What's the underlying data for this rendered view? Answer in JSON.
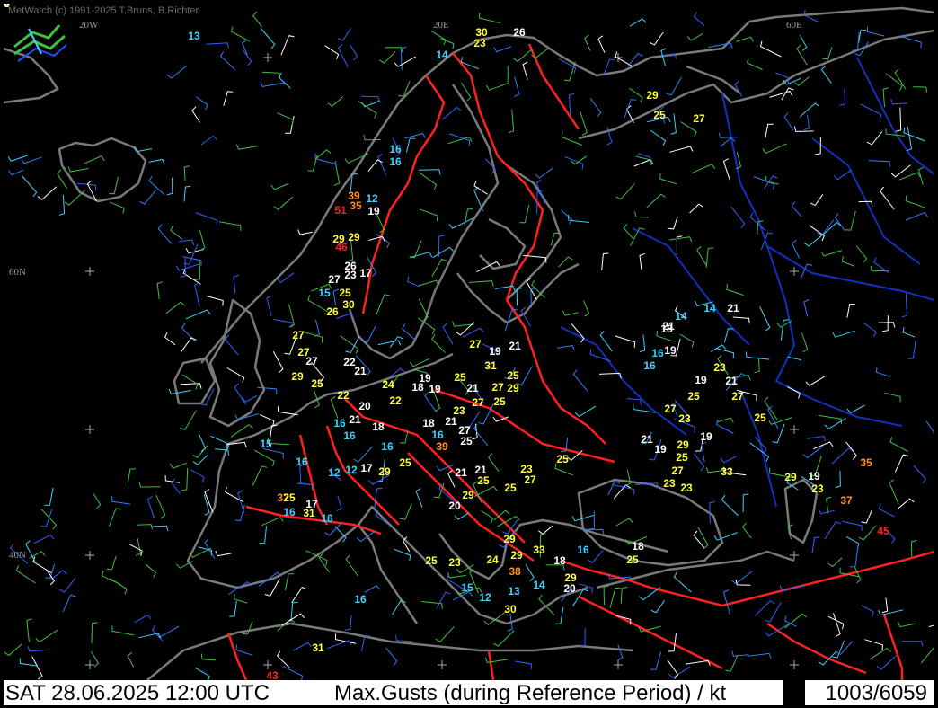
{
  "copyright": "MetWatch  (c) 1991-2025 T.Bruns, B.Richter",
  "status": {
    "datetime": "SAT 28.06.2025 12:00 UTC",
    "parameter": "Max.Gusts (during Reference Period) / kt",
    "count": "1003/6059"
  },
  "grid_labels": [
    "20W",
    "20E",
    "60E",
    "60N",
    "40N"
  ],
  "colors": {
    "background": "#000000",
    "coast": "#7a7a7a",
    "border": "#ff2020",
    "region": "#1030c0",
    "white": "#ffffff",
    "yellow": "#ffff40",
    "cyan": "#40d0ff",
    "orange": "#ff9020",
    "red": "#ff2020"
  },
  "gusts": [
    {
      "v": "13",
      "c": "cyan"
    },
    {
      "v": "30",
      "c": "yellow"
    },
    {
      "v": "26",
      "c": "white"
    },
    {
      "v": "23",
      "c": "yellow"
    },
    {
      "v": "14",
      "c": "cyan"
    },
    {
      "v": "29",
      "c": "yellow"
    },
    {
      "v": "25",
      "c": "yellow"
    },
    {
      "v": "27",
      "c": "yellow"
    },
    {
      "v": "16",
      "c": "cyan"
    },
    {
      "v": "16",
      "c": "cyan"
    },
    {
      "v": "39",
      "c": "orange"
    },
    {
      "v": "35",
      "c": "orange"
    },
    {
      "v": "51",
      "c": "red"
    },
    {
      "v": "19",
      "c": "white"
    },
    {
      "v": "12",
      "c": "cyan"
    },
    {
      "v": "29",
      "c": "yellow"
    },
    {
      "v": "29",
      "c": "yellow"
    },
    {
      "v": "46",
      "c": "red"
    },
    {
      "v": "26",
      "c": "white"
    },
    {
      "v": "23",
      "c": "white"
    },
    {
      "v": "17",
      "c": "white"
    },
    {
      "v": "27",
      "c": "white"
    },
    {
      "v": "15",
      "c": "cyan"
    },
    {
      "v": "25",
      "c": "yellow"
    },
    {
      "v": "30",
      "c": "yellow"
    },
    {
      "v": "26",
      "c": "yellow"
    },
    {
      "v": "27",
      "c": "yellow"
    },
    {
      "v": "27",
      "c": "yellow"
    },
    {
      "v": "27",
      "c": "white"
    },
    {
      "v": "22",
      "c": "white"
    },
    {
      "v": "21",
      "c": "white"
    },
    {
      "v": "29",
      "c": "yellow"
    },
    {
      "v": "25",
      "c": "yellow"
    },
    {
      "v": "22",
      "c": "yellow"
    },
    {
      "v": "20",
      "c": "white"
    },
    {
      "v": "24",
      "c": "yellow"
    },
    {
      "v": "22",
      "c": "yellow"
    },
    {
      "v": "27",
      "c": "yellow"
    },
    {
      "v": "19",
      "c": "white"
    },
    {
      "v": "21",
      "c": "white"
    },
    {
      "v": "31",
      "c": "yellow"
    },
    {
      "v": "19",
      "c": "white"
    },
    {
      "v": "18",
      "c": "white"
    },
    {
      "v": "19",
      "c": "white"
    },
    {
      "v": "25",
      "c": "yellow"
    },
    {
      "v": "21",
      "c": "white"
    },
    {
      "v": "27",
      "c": "yellow"
    },
    {
      "v": "29",
      "c": "yellow"
    },
    {
      "v": "25",
      "c": "yellow"
    },
    {
      "v": "27",
      "c": "yellow"
    },
    {
      "v": "25",
      "c": "yellow"
    },
    {
      "v": "23",
      "c": "yellow"
    },
    {
      "v": "21",
      "c": "white"
    },
    {
      "v": "27",
      "c": "white"
    },
    {
      "v": "25",
      "c": "white"
    },
    {
      "v": "18",
      "c": "white"
    },
    {
      "v": "16",
      "c": "cyan"
    },
    {
      "v": "39",
      "c": "orange"
    },
    {
      "v": "25",
      "c": "yellow"
    },
    {
      "v": "16",
      "c": "cyan"
    },
    {
      "v": "21",
      "c": "white"
    },
    {
      "v": "18",
      "c": "white"
    },
    {
      "v": "16",
      "c": "cyan"
    },
    {
      "v": "16",
      "c": "cyan"
    },
    {
      "v": "16",
      "c": "cyan"
    },
    {
      "v": "15",
      "c": "cyan"
    },
    {
      "v": "16",
      "c": "cyan"
    },
    {
      "v": "12",
      "c": "cyan"
    },
    {
      "v": "12",
      "c": "cyan"
    },
    {
      "v": "17",
      "c": "white"
    },
    {
      "v": "29",
      "c": "yellow"
    },
    {
      "v": "25",
      "c": "yellow"
    },
    {
      "v": "21",
      "c": "white"
    },
    {
      "v": "21",
      "c": "white"
    },
    {
      "v": "25",
      "c": "yellow"
    },
    {
      "v": "23",
      "c": "yellow"
    },
    {
      "v": "27",
      "c": "yellow"
    },
    {
      "v": "25",
      "c": "yellow"
    },
    {
      "v": "37",
      "c": "orange"
    },
    {
      "v": "17",
      "c": "white"
    },
    {
      "v": "31",
      "c": "yellow"
    },
    {
      "v": "16",
      "c": "cyan"
    },
    {
      "v": "29",
      "c": "yellow"
    },
    {
      "v": "20",
      "c": "white"
    },
    {
      "v": "25",
      "c": "yellow"
    },
    {
      "v": "21",
      "c": "white"
    },
    {
      "v": "18",
      "c": "white"
    },
    {
      "v": "16",
      "c": "cyan"
    },
    {
      "v": "14",
      "c": "cyan"
    },
    {
      "v": "19",
      "c": "white"
    },
    {
      "v": "16",
      "c": "cyan"
    },
    {
      "v": "14",
      "c": "cyan"
    },
    {
      "v": "21",
      "c": "white"
    },
    {
      "v": "23",
      "c": "yellow"
    },
    {
      "v": "19",
      "c": "white"
    },
    {
      "v": "21",
      "c": "white"
    },
    {
      "v": "25",
      "c": "yellow"
    },
    {
      "v": "27",
      "c": "yellow"
    },
    {
      "v": "23",
      "c": "yellow"
    },
    {
      "v": "27",
      "c": "yellow"
    },
    {
      "v": "25",
      "c": "yellow"
    },
    {
      "v": "21",
      "c": "white"
    },
    {
      "v": "19",
      "c": "white"
    },
    {
      "v": "29",
      "c": "yellow"
    },
    {
      "v": "19",
      "c": "white"
    },
    {
      "v": "25",
      "c": "yellow"
    },
    {
      "v": "27",
      "c": "yellow"
    },
    {
      "v": "33",
      "c": "yellow"
    },
    {
      "v": "23",
      "c": "yellow"
    },
    {
      "v": "23",
      "c": "yellow"
    },
    {
      "v": "29",
      "c": "yellow"
    },
    {
      "v": "19",
      "c": "white"
    },
    {
      "v": "23",
      "c": "yellow"
    },
    {
      "v": "35",
      "c": "orange"
    },
    {
      "v": "37",
      "c": "orange"
    },
    {
      "v": "45",
      "c": "red"
    },
    {
      "v": "29",
      "c": "yellow"
    },
    {
      "v": "33",
      "c": "yellow"
    },
    {
      "v": "29",
      "c": "yellow"
    },
    {
      "v": "16",
      "c": "cyan"
    },
    {
      "v": "18",
      "c": "white"
    },
    {
      "v": "25",
      "c": "yellow"
    },
    {
      "v": "25",
      "c": "yellow"
    },
    {
      "v": "23",
      "c": "yellow"
    },
    {
      "v": "24",
      "c": "yellow"
    },
    {
      "v": "38",
      "c": "orange"
    },
    {
      "v": "18",
      "c": "white"
    },
    {
      "v": "29",
      "c": "yellow"
    },
    {
      "v": "20",
      "c": "white"
    },
    {
      "v": "15",
      "c": "cyan"
    },
    {
      "v": "12",
      "c": "cyan"
    },
    {
      "v": "13",
      "c": "cyan"
    },
    {
      "v": "14",
      "c": "cyan"
    },
    {
      "v": "30",
      "c": "yellow"
    },
    {
      "v": "16",
      "c": "cyan"
    },
    {
      "v": "31",
      "c": "yellow"
    },
    {
      "v": "43",
      "c": "red"
    },
    {
      "v": "24",
      "c": "yellow"
    },
    {
      "v": "20",
      "c": "white"
    },
    {
      "v": "20",
      "c": "white"
    }
  ]
}
